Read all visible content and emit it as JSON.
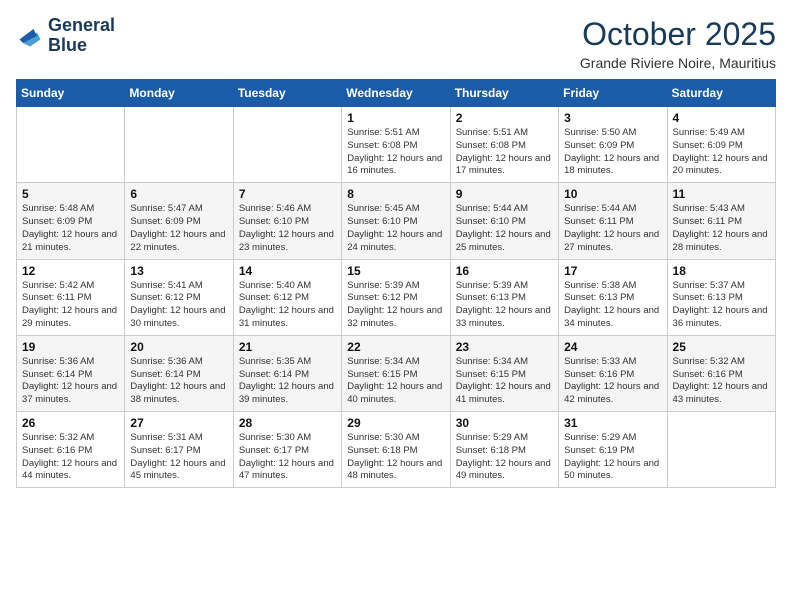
{
  "header": {
    "logo_line1": "General",
    "logo_line2": "Blue",
    "month_title": "October 2025",
    "location": "Grande Riviere Noire, Mauritius"
  },
  "weekdays": [
    "Sunday",
    "Monday",
    "Tuesday",
    "Wednesday",
    "Thursday",
    "Friday",
    "Saturday"
  ],
  "weeks": [
    [
      {
        "day": "",
        "info": ""
      },
      {
        "day": "",
        "info": ""
      },
      {
        "day": "",
        "info": ""
      },
      {
        "day": "1",
        "info": "Sunrise: 5:51 AM\nSunset: 6:08 PM\nDaylight: 12 hours and 16 minutes."
      },
      {
        "day": "2",
        "info": "Sunrise: 5:51 AM\nSunset: 6:08 PM\nDaylight: 12 hours and 17 minutes."
      },
      {
        "day": "3",
        "info": "Sunrise: 5:50 AM\nSunset: 6:09 PM\nDaylight: 12 hours and 18 minutes."
      },
      {
        "day": "4",
        "info": "Sunrise: 5:49 AM\nSunset: 6:09 PM\nDaylight: 12 hours and 20 minutes."
      }
    ],
    [
      {
        "day": "5",
        "info": "Sunrise: 5:48 AM\nSunset: 6:09 PM\nDaylight: 12 hours and 21 minutes."
      },
      {
        "day": "6",
        "info": "Sunrise: 5:47 AM\nSunset: 6:09 PM\nDaylight: 12 hours and 22 minutes."
      },
      {
        "day": "7",
        "info": "Sunrise: 5:46 AM\nSunset: 6:10 PM\nDaylight: 12 hours and 23 minutes."
      },
      {
        "day": "8",
        "info": "Sunrise: 5:45 AM\nSunset: 6:10 PM\nDaylight: 12 hours and 24 minutes."
      },
      {
        "day": "9",
        "info": "Sunrise: 5:44 AM\nSunset: 6:10 PM\nDaylight: 12 hours and 25 minutes."
      },
      {
        "day": "10",
        "info": "Sunrise: 5:44 AM\nSunset: 6:11 PM\nDaylight: 12 hours and 27 minutes."
      },
      {
        "day": "11",
        "info": "Sunrise: 5:43 AM\nSunset: 6:11 PM\nDaylight: 12 hours and 28 minutes."
      }
    ],
    [
      {
        "day": "12",
        "info": "Sunrise: 5:42 AM\nSunset: 6:11 PM\nDaylight: 12 hours and 29 minutes."
      },
      {
        "day": "13",
        "info": "Sunrise: 5:41 AM\nSunset: 6:12 PM\nDaylight: 12 hours and 30 minutes."
      },
      {
        "day": "14",
        "info": "Sunrise: 5:40 AM\nSunset: 6:12 PM\nDaylight: 12 hours and 31 minutes."
      },
      {
        "day": "15",
        "info": "Sunrise: 5:39 AM\nSunset: 6:12 PM\nDaylight: 12 hours and 32 minutes."
      },
      {
        "day": "16",
        "info": "Sunrise: 5:39 AM\nSunset: 6:13 PM\nDaylight: 12 hours and 33 minutes."
      },
      {
        "day": "17",
        "info": "Sunrise: 5:38 AM\nSunset: 6:13 PM\nDaylight: 12 hours and 34 minutes."
      },
      {
        "day": "18",
        "info": "Sunrise: 5:37 AM\nSunset: 6:13 PM\nDaylight: 12 hours and 36 minutes."
      }
    ],
    [
      {
        "day": "19",
        "info": "Sunrise: 5:36 AM\nSunset: 6:14 PM\nDaylight: 12 hours and 37 minutes."
      },
      {
        "day": "20",
        "info": "Sunrise: 5:36 AM\nSunset: 6:14 PM\nDaylight: 12 hours and 38 minutes."
      },
      {
        "day": "21",
        "info": "Sunrise: 5:35 AM\nSunset: 6:14 PM\nDaylight: 12 hours and 39 minutes."
      },
      {
        "day": "22",
        "info": "Sunrise: 5:34 AM\nSunset: 6:15 PM\nDaylight: 12 hours and 40 minutes."
      },
      {
        "day": "23",
        "info": "Sunrise: 5:34 AM\nSunset: 6:15 PM\nDaylight: 12 hours and 41 minutes."
      },
      {
        "day": "24",
        "info": "Sunrise: 5:33 AM\nSunset: 6:16 PM\nDaylight: 12 hours and 42 minutes."
      },
      {
        "day": "25",
        "info": "Sunrise: 5:32 AM\nSunset: 6:16 PM\nDaylight: 12 hours and 43 minutes."
      }
    ],
    [
      {
        "day": "26",
        "info": "Sunrise: 5:32 AM\nSunset: 6:16 PM\nDaylight: 12 hours and 44 minutes."
      },
      {
        "day": "27",
        "info": "Sunrise: 5:31 AM\nSunset: 6:17 PM\nDaylight: 12 hours and 45 minutes."
      },
      {
        "day": "28",
        "info": "Sunrise: 5:30 AM\nSunset: 6:17 PM\nDaylight: 12 hours and 47 minutes."
      },
      {
        "day": "29",
        "info": "Sunrise: 5:30 AM\nSunset: 6:18 PM\nDaylight: 12 hours and 48 minutes."
      },
      {
        "day": "30",
        "info": "Sunrise: 5:29 AM\nSunset: 6:18 PM\nDaylight: 12 hours and 49 minutes."
      },
      {
        "day": "31",
        "info": "Sunrise: 5:29 AM\nSunset: 6:19 PM\nDaylight: 12 hours and 50 minutes."
      },
      {
        "day": "",
        "info": ""
      }
    ]
  ]
}
